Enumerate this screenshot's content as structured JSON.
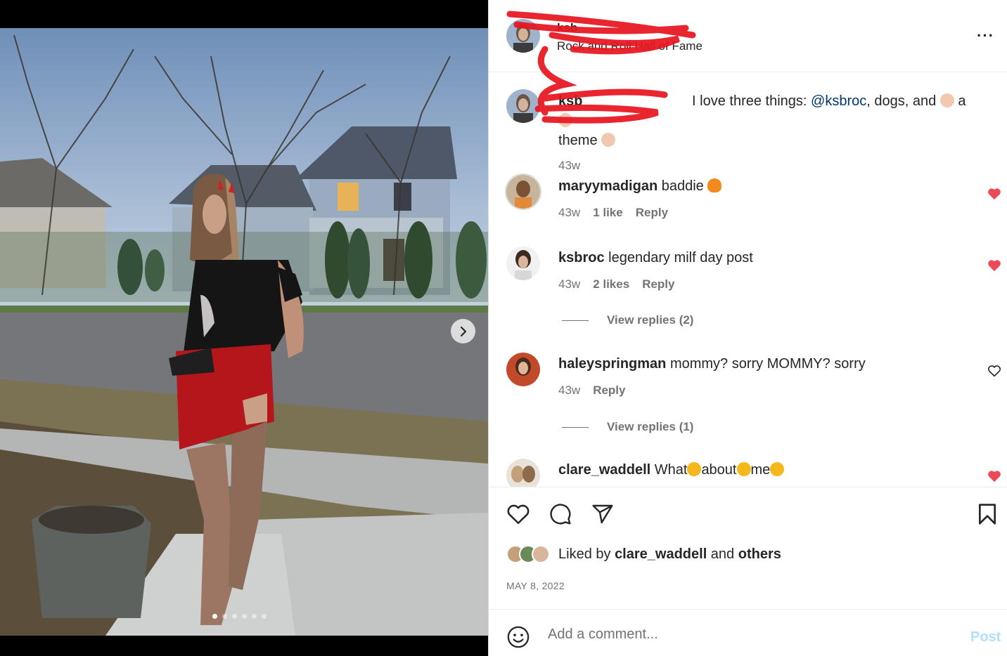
{
  "post": {
    "username": "ksb",
    "location": "Rock and Roll Hall of Fame",
    "image_count": 6,
    "active_image": 1
  },
  "caption": {
    "username": "ksb",
    "text_before": "I love three things: ",
    "mention": "@ksbroc",
    "text_after": ", dogs, and ",
    "text_a": "a",
    "text_theme": "theme",
    "time": "43w"
  },
  "comments": [
    {
      "username": "maryymadigan",
      "text": "baddie",
      "time": "43w",
      "likes": "1 like",
      "reply": "Reply",
      "liked": true
    },
    {
      "username": "ksbroc",
      "text": "legendary milf day post",
      "time": "43w",
      "likes": "2 likes",
      "reply": "Reply",
      "liked": true,
      "view_replies": "View replies (2)"
    },
    {
      "username": "haleyspringman",
      "text": "mommy? sorry MOMMY? sorry",
      "time": "43w",
      "reply": "Reply",
      "liked": false,
      "view_replies": "View replies (1)"
    },
    {
      "username": "clare_waddell",
      "text_1": "What",
      "text_2": "about",
      "text_3": "me",
      "liked": true
    }
  ],
  "likes": {
    "prefix": "Liked by ",
    "user": "clare_waddell",
    "middle": " and ",
    "others": "others"
  },
  "date": "MAY 8, 2022",
  "composer": {
    "placeholder": "Add a comment...",
    "post_label": "Post"
  },
  "colors": {
    "heart_red": "#ed4956",
    "link_blue": "#00376b",
    "post_disabled": "#b2dffc",
    "muted": "#737373",
    "redaction": "#e8141f"
  },
  "icons": [
    "next-arrow-icon",
    "more-options-icon",
    "heart-icon",
    "comment-icon",
    "share-icon",
    "bookmark-icon",
    "emoji-icon",
    "fire-emoji",
    "clap-emoji"
  ]
}
